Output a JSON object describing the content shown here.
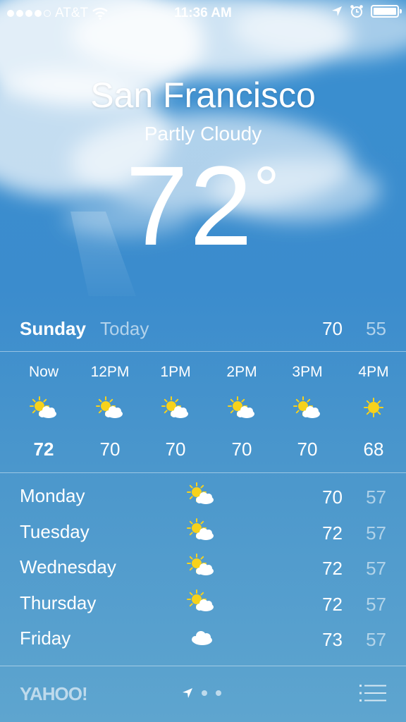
{
  "status_bar": {
    "carrier": "AT&T",
    "time": "11:36 AM",
    "signal_dots_filled": 4,
    "signal_dots_total": 5
  },
  "current": {
    "city": "San Francisco",
    "condition": "Partly Cloudy",
    "temperature": "72",
    "degree_symbol": "°"
  },
  "today": {
    "day": "Sunday",
    "label": "Today",
    "high": "70",
    "low": "55"
  },
  "hourly": [
    {
      "time": "Now",
      "temp": "72",
      "icon": "partly-cloudy-icon"
    },
    {
      "time": "12PM",
      "temp": "70",
      "icon": "partly-cloudy-icon"
    },
    {
      "time": "1PM",
      "temp": "70",
      "icon": "partly-cloudy-icon"
    },
    {
      "time": "2PM",
      "temp": "70",
      "icon": "partly-cloudy-icon"
    },
    {
      "time": "3PM",
      "temp": "70",
      "icon": "partly-cloudy-icon"
    },
    {
      "time": "4PM",
      "temp": "68",
      "icon": "sun-icon"
    }
  ],
  "daily": [
    {
      "day": "Monday",
      "high": "70",
      "low": "57",
      "icon": "partly-cloudy-icon"
    },
    {
      "day": "Tuesday",
      "high": "72",
      "low": "57",
      "icon": "partly-cloudy-icon"
    },
    {
      "day": "Wednesday",
      "high": "72",
      "low": "57",
      "icon": "partly-cloudy-icon"
    },
    {
      "day": "Thursday",
      "high": "72",
      "low": "57",
      "icon": "partly-cloudy-icon"
    },
    {
      "day": "Friday",
      "high": "73",
      "low": "57",
      "icon": "cloud-icon"
    }
  ],
  "footer": {
    "brand": "YAHOO!"
  },
  "colors": {
    "sun": "#f7d21b",
    "cloud": "#ffffff",
    "dim_text": "rgba(255,255,255,0.6)"
  }
}
